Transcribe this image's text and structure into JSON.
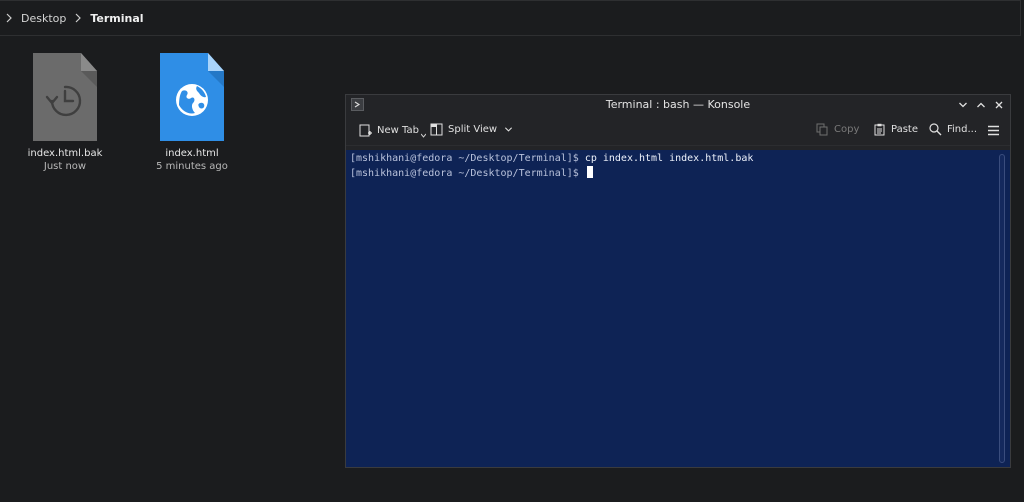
{
  "breadcrumb": {
    "items": [
      "Desktop",
      "Terminal"
    ]
  },
  "files": [
    {
      "name": "index.html.bak",
      "subtitle": "Just now",
      "icon": "backup-file-icon"
    },
    {
      "name": "index.html",
      "subtitle": "5 minutes ago",
      "icon": "html-file-icon"
    }
  ],
  "konsole": {
    "title": "Terminal : bash — Konsole",
    "toolbar": {
      "new_tab": "New Tab",
      "split_view": "Split View",
      "copy": "Copy",
      "paste": "Paste",
      "find": "Find..."
    },
    "terminal": {
      "lines": [
        {
          "prompt": "[mshikhani@fedora ~/Desktop/Terminal]$",
          "command": "cp index.html index.html.bak"
        },
        {
          "prompt": "[mshikhani@fedora ~/Desktop/Terminal]$",
          "command": ""
        }
      ]
    }
  },
  "colors": {
    "desktop_bg": "#1b1c1e",
    "terminal_bg": "#0e2355",
    "html_icon": "#2f8ee6",
    "backup_icon": "#6b6b6b"
  }
}
